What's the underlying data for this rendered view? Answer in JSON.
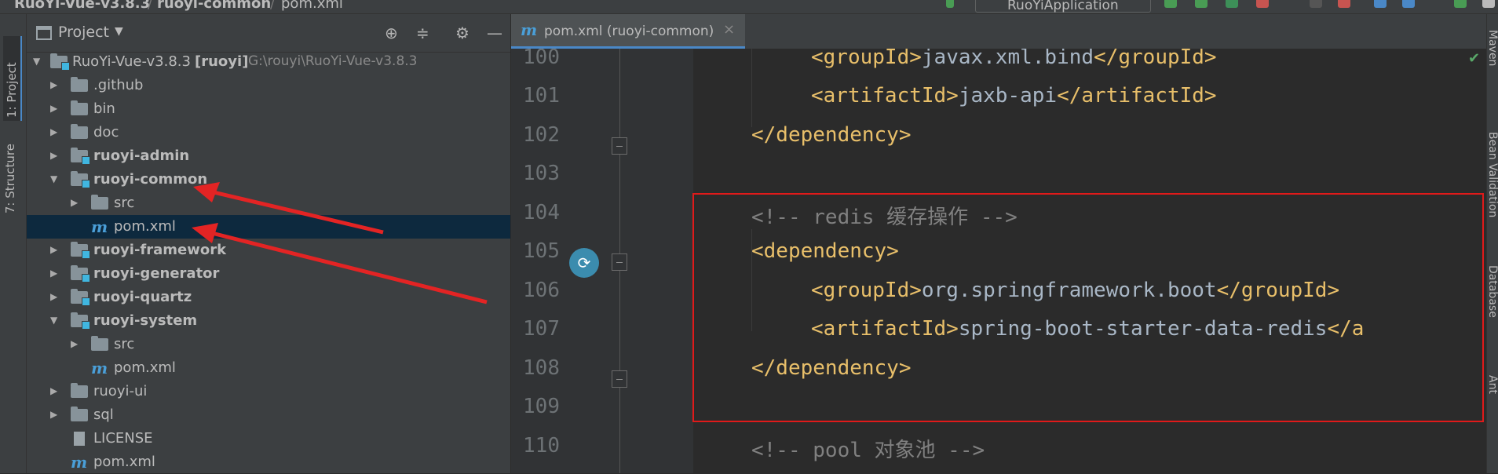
{
  "breadcrumb": [
    "RuoYi-Vue-v3.8.3",
    "ruoyi-common",
    "pom.xml"
  ],
  "run_config": "RuoYiApplication",
  "left_tabs": {
    "project": "1: Project",
    "structure": "7: Structure"
  },
  "project_panel": {
    "title": "Project",
    "root": {
      "name": "RuoYi-Vue-v3.8.3",
      "module": "[ruoyi]",
      "path": "G:\\rouyi\\RuoYi-Vue-v3.8.3"
    },
    "items": [
      {
        "label": ".github"
      },
      {
        "label": "bin"
      },
      {
        "label": "doc"
      },
      {
        "label": "ruoyi-admin"
      },
      {
        "label": "ruoyi-common"
      },
      {
        "label": "src"
      },
      {
        "label": "pom.xml"
      },
      {
        "label": "ruoyi-framework"
      },
      {
        "label": "ruoyi-generator"
      },
      {
        "label": "ruoyi-quartz"
      },
      {
        "label": "ruoyi-system"
      },
      {
        "label": "src"
      },
      {
        "label": "pom.xml"
      },
      {
        "label": "ruoyi-ui"
      },
      {
        "label": "sql"
      },
      {
        "label": "LICENSE"
      },
      {
        "label": "pom.xml"
      }
    ]
  },
  "editor": {
    "tab_label": "pom.xml (ruoyi-common)",
    "tab_close": "×",
    "file_icon": "m",
    "line_numbers": [
      "100",
      "101",
      "102",
      "103",
      "104",
      "105",
      "106",
      "107",
      "108",
      "109",
      "110"
    ],
    "lines": {
      "l100": {
        "open": "<groupId>",
        "text": "javax.xml.bind",
        "close": "</groupId>"
      },
      "l101": {
        "open": "<artifactId>",
        "text": "jaxb-api",
        "close": "</artifactId>"
      },
      "l102": "</dependency>",
      "l104": "<!-- redis 缓存操作 -->",
      "l105": "<dependency>",
      "l106": {
        "open": "<groupId>",
        "text": "org.springframework.boot",
        "close": "</groupId>"
      },
      "l107": {
        "open": "<artifactId>",
        "text": "spring-boot-starter-data-redis",
        "close": "</a"
      },
      "l108": "</dependency>",
      "l110": "<!-- pool 对象池 -->"
    }
  },
  "right_tabs": [
    "Maven",
    "Bean Validation",
    "Database",
    "Ant"
  ],
  "colors": {
    "tag": "#e8bf6a",
    "comment": "#808080",
    "highlight_box": "#e01a1a",
    "annotation_arrow": "#e32424"
  }
}
